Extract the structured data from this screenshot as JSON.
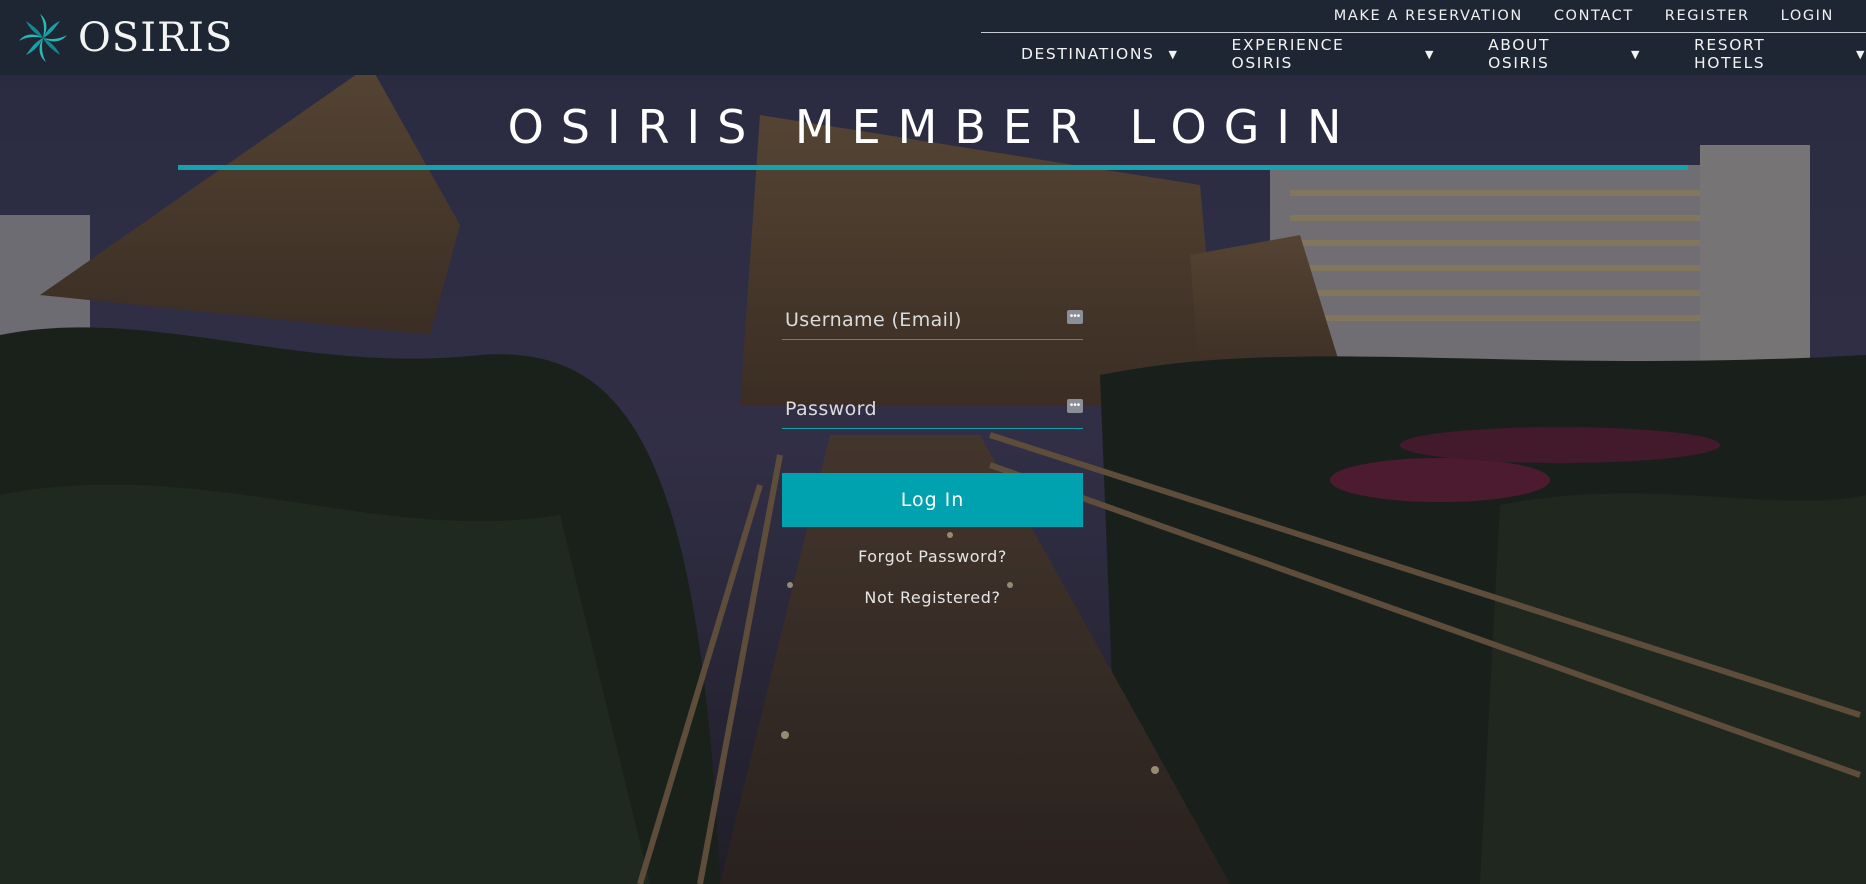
{
  "header": {
    "logo_text": "OSIRIS",
    "utility_nav": [
      "MAKE A RESERVATION",
      "CONTACT",
      "REGISTER",
      "LOGIN"
    ],
    "main_nav": [
      {
        "label": "DESTINATIONS",
        "caret": "▼"
      },
      {
        "label": "EXPERIENCE OSIRIS",
        "caret": "▼"
      },
      {
        "label": "ABOUT OSIRIS",
        "caret": "▼"
      },
      {
        "label": "RESORT HOTELS",
        "caret": "▼"
      }
    ]
  },
  "hero": {
    "title": "OSIRIS MEMBER LOGIN"
  },
  "form": {
    "username_placeholder": "Username (Email)",
    "password_placeholder": "Password",
    "field_icon": "•••",
    "login_label": "Log In",
    "forgot_password": "Forgot Password?",
    "not_registered": "Not Registered?"
  },
  "colors": {
    "header_bg": "#1e2533",
    "accent": "#00a2b0",
    "title_rule": "#14a3ae"
  },
  "icons": {
    "logo": "four-leaf-pinwheel-icon",
    "caret": "caret-down-icon",
    "field": "password-manager-dots-icon"
  }
}
